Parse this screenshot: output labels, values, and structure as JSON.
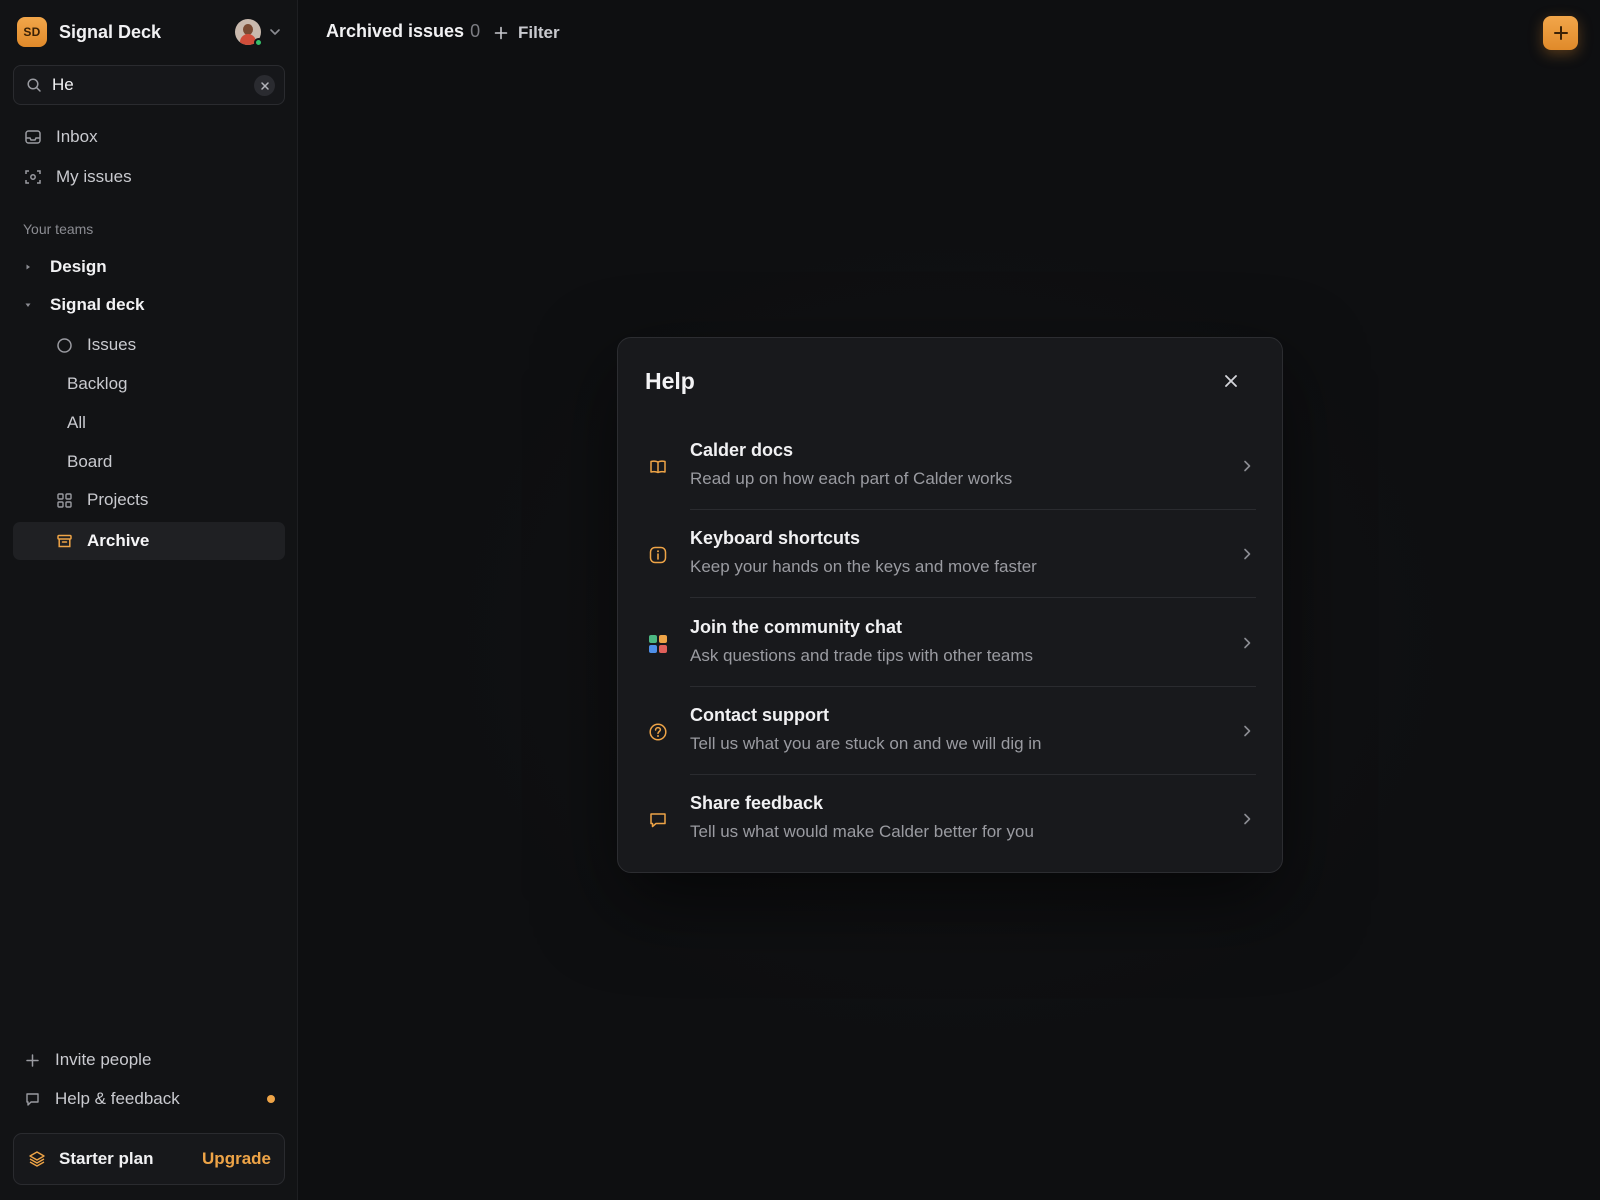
{
  "workspace": {
    "logo_text": "SD",
    "name": "Signal Deck",
    "brand_color": "#eea447"
  },
  "search": {
    "value": "He",
    "placeholder": "Search"
  },
  "nav": {
    "inbox": "Inbox",
    "my_issues": "My issues"
  },
  "teams": {
    "section_label": "Your teams",
    "design": "Design",
    "signal_deck": "Signal deck",
    "items": {
      "issues": "Issues",
      "backlog": "Backlog",
      "all": "All",
      "board": "Board",
      "projects": "Projects",
      "archive": "Archive"
    }
  },
  "bottom": {
    "invite": "Invite people",
    "help": "Help & feedback"
  },
  "plan": {
    "name": "Starter plan",
    "upgrade": "Upgrade"
  },
  "header": {
    "title": "Archived issues",
    "count": "0",
    "filter": "Filter"
  },
  "help_modal": {
    "title": "Help",
    "items": [
      {
        "title": "Calder docs",
        "desc": "Read up on how each part of Calder works",
        "icon": "book-icon"
      },
      {
        "title": "Keyboard shortcuts",
        "desc": "Keep your hands on the keys and move faster",
        "icon": "info-icon"
      },
      {
        "title": "Join the community chat",
        "desc": "Ask questions and trade tips with other teams",
        "icon": "community-icon"
      },
      {
        "title": "Contact support",
        "desc": "Tell us what you are stuck on and we will dig in",
        "icon": "question-icon"
      },
      {
        "title": "Share feedback",
        "desc": "Tell us what would make Calder better for you",
        "icon": "chat-bubble-icon"
      }
    ]
  }
}
